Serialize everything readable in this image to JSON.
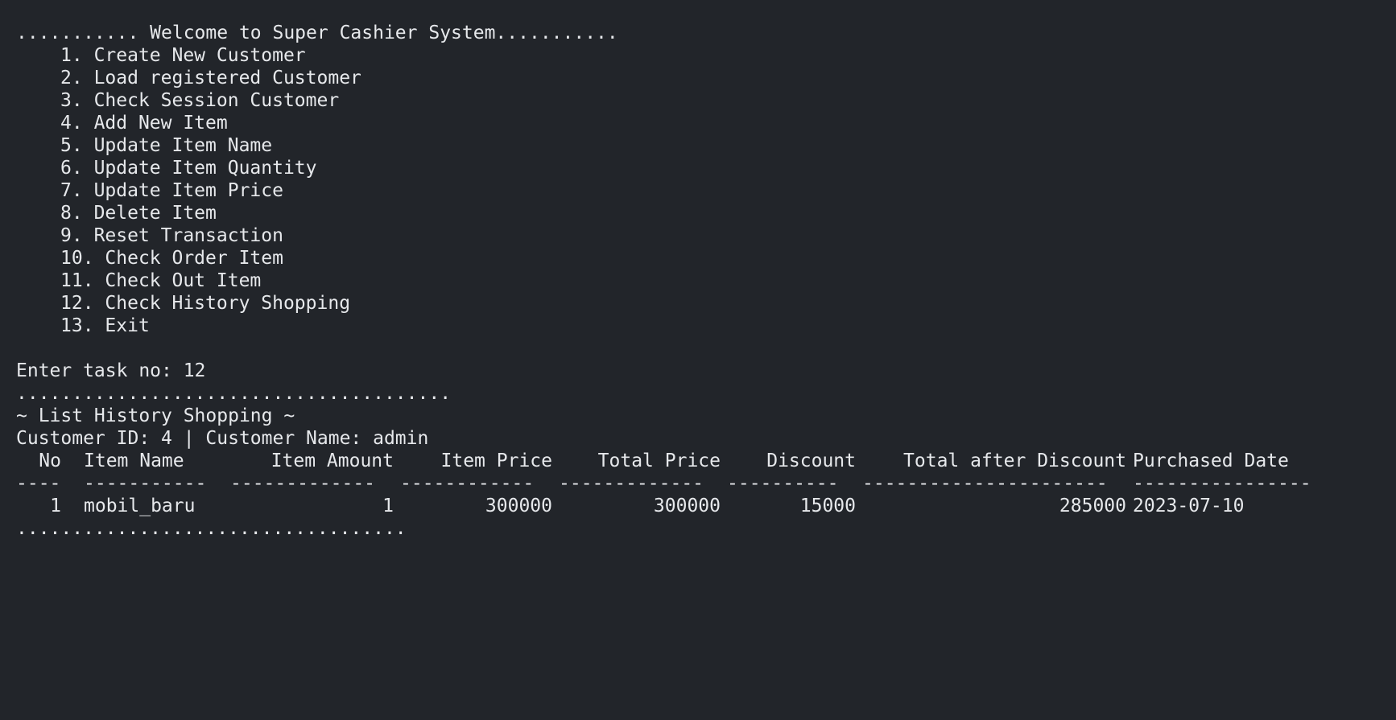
{
  "banner": "........... Welcome to Super Cashier System...........",
  "menu": [
    {
      "no": "1.",
      "label": "Create New Customer"
    },
    {
      "no": "2.",
      "label": "Load registered Customer"
    },
    {
      "no": "3.",
      "label": "Check Session Customer"
    },
    {
      "no": "4.",
      "label": "Add New Item"
    },
    {
      "no": "5.",
      "label": "Update Item Name"
    },
    {
      "no": "6.",
      "label": "Update Item Quantity"
    },
    {
      "no": "7.",
      "label": "Update Item Price"
    },
    {
      "no": "8.",
      "label": "Delete Item"
    },
    {
      "no": "9.",
      "label": "Reset Transaction"
    },
    {
      "no": "10.",
      "label": "Check Order Item"
    },
    {
      "no": "11.",
      "label": "Check Out Item"
    },
    {
      "no": "12.",
      "label": "Check History Shopping"
    },
    {
      "no": "13.",
      "label": "Exit"
    }
  ],
  "prompt": "Enter task no: 12",
  "separator_top": ".......................................",
  "history_title": "~ List History Shopping ~",
  "customer_info": "Customer ID: 4 | Customer Name: admin",
  "table": {
    "headers": [
      "No",
      "Item Name",
      "Item Amount",
      "Item Price",
      "Total Price",
      "Discount",
      "Total after Discount",
      "Purchased Date"
    ],
    "rules": [
      "----",
      "-----------",
      "-------------",
      "------------",
      "-------------",
      "----------",
      "----------------------",
      "----------------"
    ],
    "rows": [
      [
        "1",
        "mobil_baru",
        "1",
        "300000",
        "300000",
        "15000",
        "285000",
        "2023-07-10"
      ]
    ]
  },
  "separator_bottom": "..................................."
}
